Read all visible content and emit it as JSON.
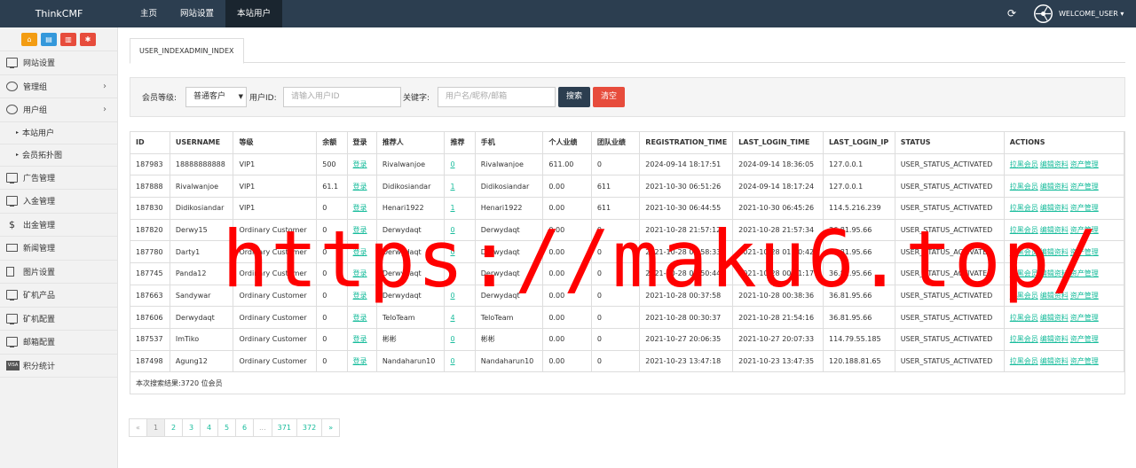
{
  "brand": "ThinkCMF",
  "top_nav": [
    {
      "label": "主页"
    },
    {
      "label": "网站设置"
    },
    {
      "label": "本站用户",
      "active": true
    }
  ],
  "user_menu": {
    "label": "WELCOME_USER ▾",
    "refresh_icon": "refresh-icon"
  },
  "sidebar": {
    "shortcuts": [
      {
        "icon": "home-icon",
        "color": "#f39c12"
      },
      {
        "icon": "file-icon",
        "color": "#3498db"
      },
      {
        "icon": "trash-icon",
        "color": "#e74c3c"
      },
      {
        "icon": "clear-cache-icon",
        "color": "#e74c3c"
      }
    ],
    "items": [
      {
        "label": "网站设置",
        "icon": "monitor-icon"
      },
      {
        "label": "管理组",
        "icon": "user-circle-icon",
        "arrow": "›"
      },
      {
        "label": "用户组",
        "icon": "user-icon",
        "arrow": "›"
      },
      {
        "label": "本站用户",
        "sub": true
      },
      {
        "label": "会员拓扑图",
        "sub": true
      },
      {
        "label": "广告管理",
        "icon": "monitor-icon"
      },
      {
        "label": "入金管理",
        "icon": "monitor-icon"
      },
      {
        "label": "出金管理",
        "icon": "dollar-icon"
      },
      {
        "label": "新闻管理",
        "icon": "newspaper-icon"
      },
      {
        "label": "图片设置",
        "icon": "image-file-icon"
      },
      {
        "label": "矿机产品",
        "icon": "monitor-icon"
      },
      {
        "label": "矿机配置",
        "icon": "monitor-icon"
      },
      {
        "label": "邮箱配置",
        "icon": "monitor-icon"
      },
      {
        "label": "积分统计",
        "icon": "visa-icon"
      }
    ]
  },
  "tab": {
    "label": "USER_INDEXADMIN_INDEX"
  },
  "filter": {
    "level_label": "会员等级:",
    "level_value": "普通客户",
    "uid_label": "用户ID:",
    "uid_placeholder": "请输入用户ID",
    "keyword_label": "关键字:",
    "keyword_placeholder": "用户名/昵称/邮箱",
    "search_label": "搜索",
    "clear_label": "清空"
  },
  "table": {
    "columns": [
      "ID",
      "USERNAME",
      "等级",
      "余额",
      "登录",
      "推荐人",
      "推荐",
      "手机",
      "个人业绩",
      "团队业绩",
      "REGISTRATION_TIME",
      "LAST_LOGIN_TIME",
      "LAST_LOGIN_IP",
      "STATUS",
      "ACTIONS"
    ],
    "login_link": "登录",
    "actions": [
      "拉黑会员",
      "编辑资料",
      "资产管理"
    ],
    "rows": [
      [
        "187983",
        "18888888888",
        "VIP1",
        "500",
        "登录",
        "Rivalwanjoe",
        "0",
        "Rivalwanjoe",
        "611.00",
        "0",
        "2024-09-14 18:17:51",
        "2024-09-14 18:36:05",
        "127.0.0.1",
        "USER_STATUS_ACTIVATED"
      ],
      [
        "187888",
        "Rivalwanjoe",
        "VIP1",
        "61.1",
        "登录",
        "Didikosiandar",
        "1",
        "Didikosiandar",
        "0.00",
        "611",
        "2021-10-30 06:51:26",
        "2024-09-14 18:17:24",
        "127.0.0.1",
        "USER_STATUS_ACTIVATED"
      ],
      [
        "187830",
        "Didikosiandar",
        "VIP1",
        "0",
        "登录",
        "Henari1922",
        "1",
        "Henari1922",
        "0.00",
        "611",
        "2021-10-30 06:44:55",
        "2021-10-30 06:45:26",
        "114.5.216.239",
        "USER_STATUS_ACTIVATED"
      ],
      [
        "187820",
        "Derwy15",
        "Ordinary Customer",
        "0",
        "登录",
        "Derwydaqt",
        "0",
        "Derwydaqt",
        "0.00",
        "0",
        "2021-10-28 21:57:12",
        "2021-10-28 21:57:34",
        "36.81.95.66",
        "USER_STATUS_ACTIVATED"
      ],
      [
        "187780",
        "Darty1",
        "Ordinary Customer",
        "0",
        "登录",
        "Derwydaqt",
        "0",
        "Derwydaqt",
        "0.00",
        "0",
        "2021-10-28 00:58:33",
        "2021-10-28 01:00:42",
        "36.81.95.66",
        "USER_STATUS_ACTIVATED"
      ],
      [
        "187745",
        "Panda12",
        "Ordinary Customer",
        "0",
        "登录",
        "Derwydaqt",
        "0",
        "Derwydaqt",
        "0.00",
        "0",
        "2021-10-28 00:50:44",
        "2021-10-28 00:51:17",
        "36.81.95.66",
        "USER_STATUS_ACTIVATED"
      ],
      [
        "187663",
        "Sandywar",
        "Ordinary Customer",
        "0",
        "登录",
        "Derwydaqt",
        "0",
        "Derwydaqt",
        "0.00",
        "0",
        "2021-10-28 00:37:58",
        "2021-10-28 00:38:36",
        "36.81.95.66",
        "USER_STATUS_ACTIVATED"
      ],
      [
        "187606",
        "Derwydaqt",
        "Ordinary Customer",
        "0",
        "登录",
        "TeloTeam",
        "4",
        "TeloTeam",
        "0.00",
        "0",
        "2021-10-28 00:30:37",
        "2021-10-28 21:54:16",
        "36.81.95.66",
        "USER_STATUS_ACTIVATED"
      ],
      [
        "187537",
        "ImTiko",
        "Ordinary Customer",
        "0",
        "登录",
        "彬彬",
        "0",
        "彬彬",
        "0.00",
        "0",
        "2021-10-27 20:06:35",
        "2021-10-27 20:07:33",
        "114.79.55.185",
        "USER_STATUS_ACTIVATED"
      ],
      [
        "187498",
        "Agung12",
        "Ordinary Customer",
        "0",
        "登录",
        "Nandaharun10",
        "0",
        "Nandaharun10",
        "0.00",
        "0",
        "2021-10-23 13:47:18",
        "2021-10-23 13:47:35",
        "120.188.81.65",
        "USER_STATUS_ACTIVATED"
      ]
    ],
    "total_text": "本次搜索结果:3720 位会员"
  },
  "pagination": [
    "«",
    "1",
    "2",
    "3",
    "4",
    "5",
    "6",
    "...",
    "371",
    "372",
    "»"
  ],
  "watermark": "https://maku6.top/"
}
